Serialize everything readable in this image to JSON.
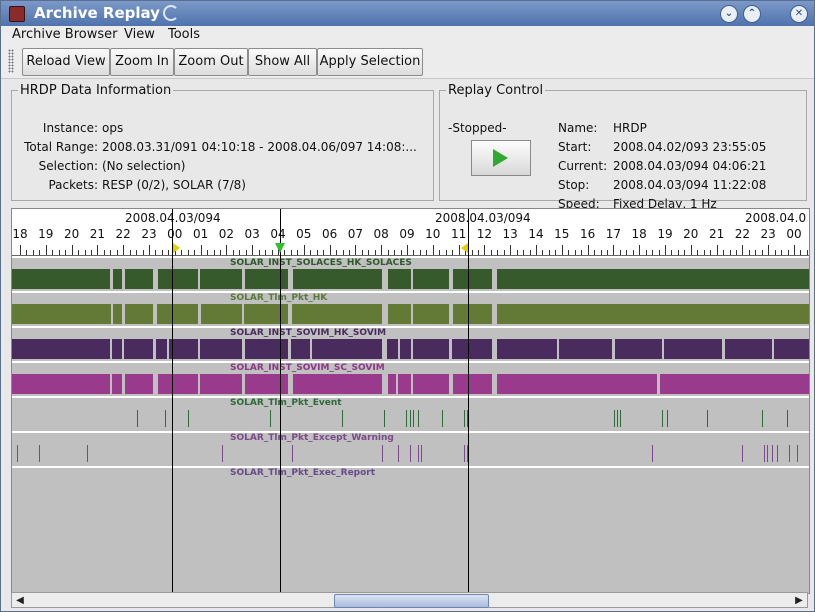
{
  "window": {
    "title": "Archive Replay"
  },
  "menu": [
    "Archive Browser",
    "View",
    "Tools"
  ],
  "toolbar": {
    "reload": "Reload View",
    "zoom_in": "Zoom In",
    "zoom_out": "Zoom Out",
    "show_all": "Show All",
    "apply": "Apply Selection"
  },
  "hrdp": {
    "legend": "HRDP Data Information",
    "instance_label": "Instance:",
    "instance": "ops",
    "range_label": "Total Range:",
    "range": "2008.03.31/091 04:10:18 - 2008.04.06/097 14:08:...",
    "selection_label": "Selection:",
    "selection": "(No selection)",
    "packets_label": "Packets:",
    "packets": "RESP (0/2), SOLAR (7/8)"
  },
  "replay": {
    "legend": "Replay Control",
    "state": "-Stopped-",
    "name_label": "Name:",
    "name": "HRDP",
    "start_label": "Start:",
    "start": "2008.04.02/093 23:55:05",
    "current_label": "Current:",
    "current": "2008.04.03/094 04:06:21",
    "stop_label": "Stop:",
    "stop": "2008.04.03/094 11:22:08",
    "speed_label": "Speed:",
    "speed": "Fixed Delay, 1 Hz"
  },
  "timeline": {
    "dates": [
      "2008.04.03/094",
      "2008.04.03/094",
      "2008.04.0"
    ],
    "hours": [
      "18",
      "19",
      "20",
      "21",
      "22",
      "23",
      "00",
      "01",
      "02",
      "03",
      "04",
      "05",
      "06",
      "07",
      "08",
      "09",
      "10",
      "11",
      "12",
      "13",
      "14",
      "15",
      "16",
      "17",
      "18",
      "19",
      "20",
      "21",
      "22",
      "23",
      "00"
    ],
    "tracks": [
      {
        "name": "SOLAR_INST_SOLACES_HK_SOLACES",
        "color": "#365a2c",
        "label_color": "#2f5a2a",
        "kind": "bar"
      },
      {
        "name": "SOLAR_Tlm_Pkt_HK",
        "color": "#627a35",
        "label_color": "#5a7a3a",
        "kind": "bar"
      },
      {
        "name": "SOLAR_INST_SOVIM_HK_SOVIM",
        "color": "#4a2b5e",
        "label_color": "#4a2d60",
        "kind": "bar"
      },
      {
        "name": "SOLAR_INST_SOVIM_SC_SOVIM",
        "color": "#9a3a8c",
        "label_color": "#8a3a84",
        "kind": "bar"
      },
      {
        "name": "SOLAR_Tlm_Pkt_Event",
        "color": "#2e6a3a",
        "label_color": "#2e6a3a",
        "kind": "event"
      },
      {
        "name": "SOLAR_Tlm_Pkt_Except_Warning",
        "color": "#7a4a8a",
        "label_color": "#7a4a8a",
        "kind": "event"
      },
      {
        "name": "SOLAR_Tlm_Pkt_Exec_Report",
        "color": "#6a4a8a",
        "label_color": "#6a4a8a",
        "kind": "event"
      }
    ]
  }
}
